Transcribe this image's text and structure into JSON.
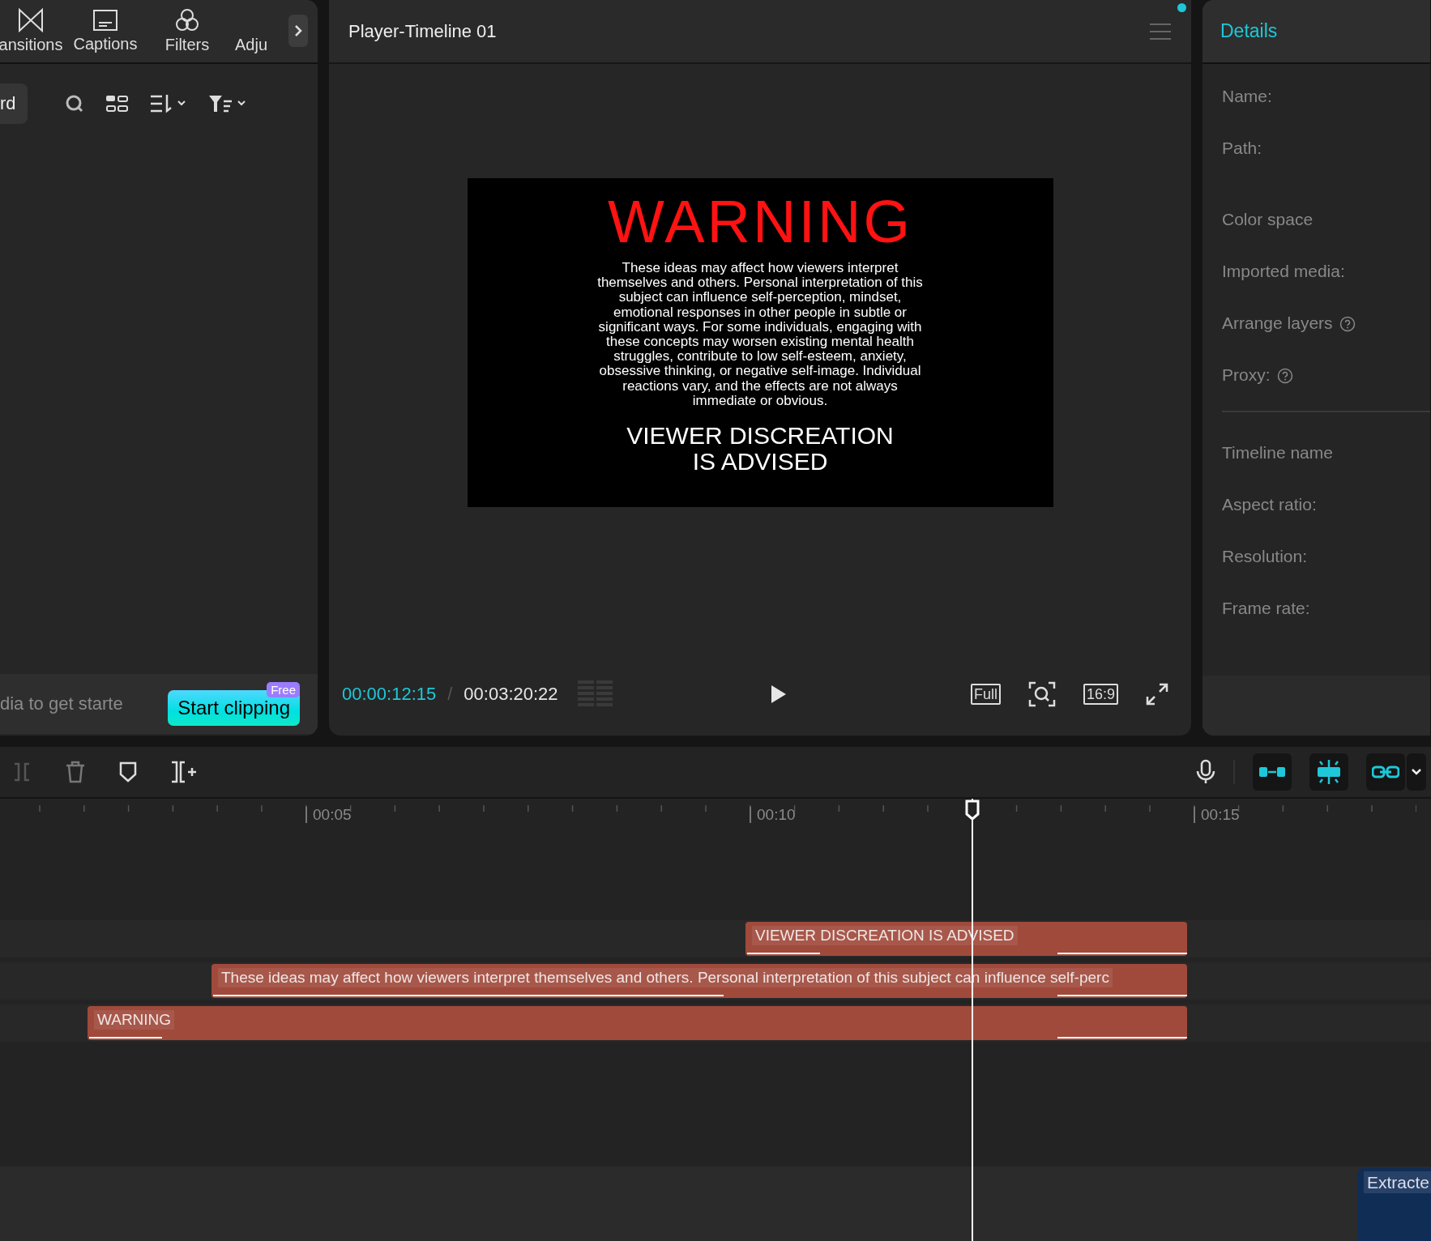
{
  "left_panel": {
    "tabs": [
      {
        "label": "ansitions"
      },
      {
        "label": "Captions"
      },
      {
        "label": "Filters"
      },
      {
        "label": "Adju"
      }
    ],
    "toolbar": {
      "button_label": "rd"
    },
    "hint": "dia to get starte",
    "start_button": {
      "label": "Start clipping",
      "badge": "Free"
    }
  },
  "player": {
    "title": "Player-Timeline 01",
    "video": {
      "title": "WARNING",
      "body": "These ideas may affect how viewers interpret themselves and others. Personal interpretation of this subject can influence self-perception, mindset, emotional responses in other people in subtle or significant ways. For some individuals, engaging with these concepts may worsen existing mental health struggles, contribute to low self-esteem, anxiety, obsessive thinking, or negative self-image. Individual reactions vary, and the effects are not always immediate or obvious.",
      "footer": "VIEWER DISCREATION IS ADVISED"
    },
    "current_time": "00:00:12:15",
    "separator": "/",
    "total_time": "00:03:20:22",
    "full_label": "Full",
    "ratio_label": "16:9"
  },
  "details": {
    "title": "Details",
    "media_fields": [
      {
        "label": "Name:",
        "has_help": false
      },
      {
        "label": "Path:",
        "has_help": false
      },
      {
        "label": "Color space",
        "has_help": false
      },
      {
        "label": "Imported media:",
        "has_help": false
      },
      {
        "label": "Arrange layers",
        "has_help": true
      },
      {
        "label": "Proxy:",
        "has_help": true
      }
    ],
    "timeline_fields": [
      {
        "label": "Timeline name",
        "has_help": false
      },
      {
        "label": "Aspect ratio:",
        "has_help": false
      },
      {
        "label": "Resolution:",
        "has_help": false
      },
      {
        "label": "Frame rate:",
        "has_help": false
      }
    ]
  },
  "timeline": {
    "ruler": [
      "00:05",
      "00:10",
      "00:15"
    ],
    "tracks": [
      {
        "clip": "VIEWER DISCREATION IS ADVISED"
      },
      {
        "clip": "These ideas may affect how viewers interpret themselves and others. Personal interpretation of this subject can influence self-perc"
      },
      {
        "clip": "WARNING"
      }
    ],
    "extracted_clip": "Extracte"
  }
}
